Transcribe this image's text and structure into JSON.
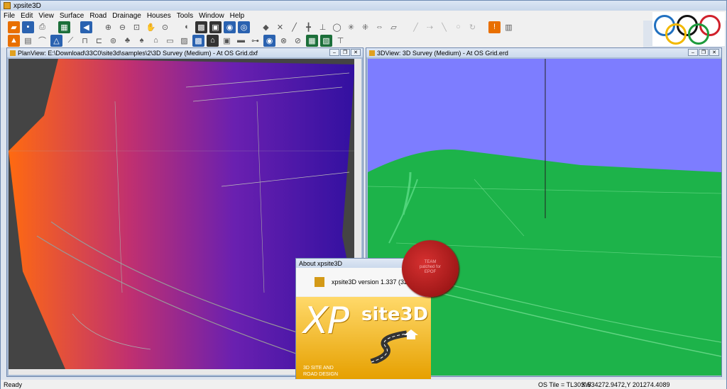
{
  "window": {
    "title": "xpsite3D"
  },
  "menu": [
    "File",
    "Edit",
    "View",
    "Surface",
    "Road",
    "Drainage",
    "Houses",
    "Tools",
    "Window",
    "Help"
  ],
  "toolbar1": [
    "open-icon",
    "save-icon",
    "print-icon",
    "sep",
    "surface-icon",
    "sep",
    "back-icon",
    "sep",
    "zoom-in-icon",
    "zoom-out-icon",
    "zoom-window-icon",
    "pan-icon",
    "zoom-all-icon",
    "sep",
    "view-2d3d-icon",
    "render-icon",
    "shade-icon",
    "sky-icon",
    "camera-icon",
    "sep",
    "point-icon",
    "cross-icon",
    "line-icon",
    "sep",
    "tangent-icon",
    "circle-icon",
    "star-icon",
    "node-icon",
    "measure-icon",
    "sep",
    "ruler-icon",
    "sep",
    "faded-icon",
    "faded-icon",
    "faded-icon",
    "faded-icon",
    "faded-icon",
    "sep",
    "alert-icon",
    "grid-icon"
  ],
  "toolbar2": [
    "warning-icon",
    "road-icon",
    "bridge-icon",
    "triangle-icon",
    "grade-icon",
    "section-icon",
    "cut-icon",
    "pin-icon",
    "tree-icon",
    "tree2-icon",
    "house-icon",
    "fence-icon",
    "boundary-icon",
    "terrain-icon",
    "house2-icon",
    "building-icon",
    "kerb-icon",
    "vehicle-icon",
    "target-icon",
    "drain-icon",
    "pipe-icon",
    "green-icon",
    "green2-icon",
    "sign-icon"
  ],
  "plan_view": {
    "title": "PlanView: E:\\Download\\33C0\\site3d\\samples\\2\\3D Survey (Medium) - At OS Grid.dxf"
  },
  "view_3d": {
    "title": "3DView: 3D Survey (Medium) - At OS Grid.erd"
  },
  "about": {
    "title": "About xpsite3D",
    "version": "xpsite3D version 1.337 (32bit)",
    "logo_xp": "XP",
    "logo_site": "site3D",
    "tagline_1": "3D SITE AND",
    "tagline_2": "ROAD DESIGN"
  },
  "seal": {
    "text_1": "TEAM",
    "text_2": "patched for",
    "text_3": "EPOF"
  },
  "status": {
    "left": "Ready",
    "os_tile": "OS Tile = TL30SW",
    "coords": "X 534272.9472,Y 201274.4089"
  },
  "colors": {
    "accent": "#2a62b0",
    "terrain": "#1db34a",
    "sky": "#7d7dff"
  }
}
